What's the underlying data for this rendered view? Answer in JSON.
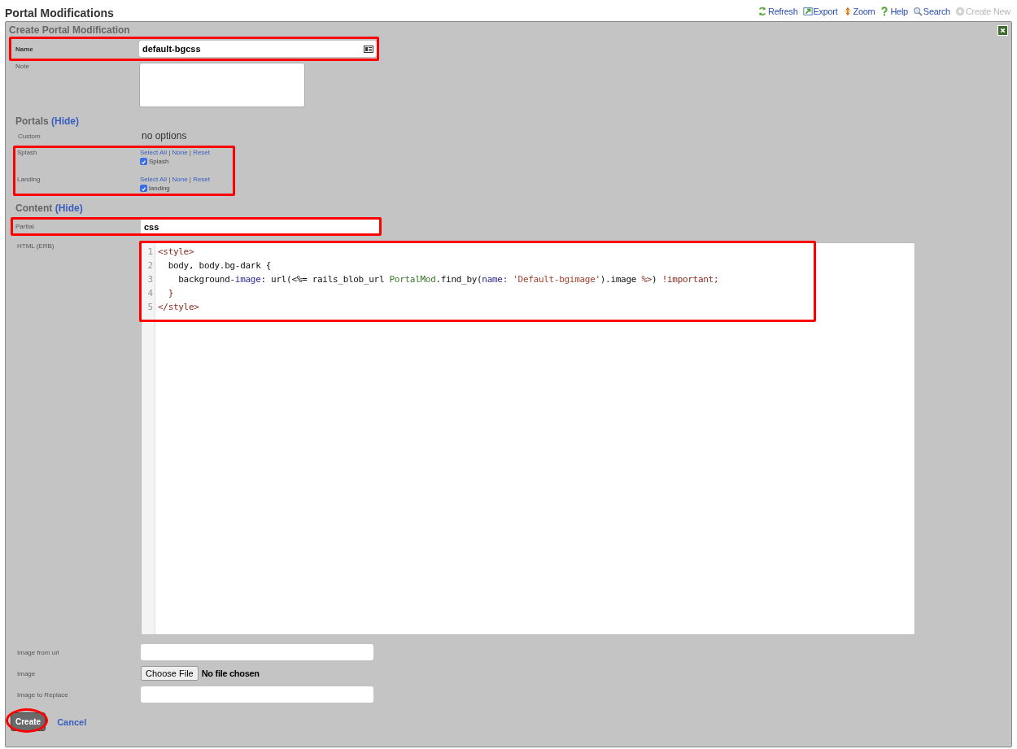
{
  "page_title": "Portal Modifications",
  "toolbar": [
    {
      "label": "Refresh",
      "kind": "refresh",
      "disabled": false
    },
    {
      "label": "Export",
      "kind": "export",
      "disabled": false
    },
    {
      "label": "Zoom",
      "kind": "zoom",
      "disabled": false
    },
    {
      "label": "Help",
      "kind": "help",
      "disabled": false
    },
    {
      "label": "Search",
      "kind": "search",
      "disabled": false
    },
    {
      "label": "Create New",
      "kind": "create",
      "disabled": true
    }
  ],
  "form": {
    "title": "Create Portal Modification",
    "name": {
      "label": "Name",
      "value": "default-bgcss",
      "highlighted": true
    },
    "note": {
      "label": "Note"
    },
    "portals": {
      "heading": "Portals",
      "toggle": "(Hide)",
      "custom": {
        "label": "Custom",
        "value": "no options"
      },
      "highlighted": true,
      "groups": [
        {
          "label": "Splash",
          "links": [
            "Select All",
            "None",
            "Reset"
          ],
          "separator": "|",
          "options": [
            {
              "label": "Splash",
              "checked": true
            }
          ]
        },
        {
          "label": "Landing",
          "links": [
            "Select All",
            "None",
            "Reset"
          ],
          "separator": "|",
          "options": [
            {
              "label": "landing",
              "checked": true
            }
          ]
        }
      ]
    },
    "content": {
      "heading": "Content",
      "toggle": "(Hide)",
      "partial": {
        "label": "Partial",
        "value": "css",
        "highlighted": true
      },
      "html": {
        "label": "HTML (ERB)",
        "highlighted": true,
        "lines": [
          {
            "number": "1",
            "tokens": [
              {
                "text": "<style>",
                "kind": "tag"
              }
            ]
          },
          {
            "number": "2",
            "tokens": [
              {
                "text": "  body, body.bg-dark {",
                "kind": "plain"
              }
            ]
          },
          {
            "number": "3",
            "tokens": [
              {
                "text": "    background-",
                "kind": "plain"
              },
              {
                "text": "image",
                "kind": "attr"
              },
              {
                "text": ": url(<%= rails_blob_url ",
                "kind": "plain"
              },
              {
                "text": "PortalMod",
                "kind": "const"
              },
              {
                "text": ".find_by(",
                "kind": "plain"
              },
              {
                "text": "name: ",
                "kind": "attr"
              },
              {
                "text": "'Default-bgimage'",
                "kind": "string"
              },
              {
                "text": ").image ",
                "kind": "plain"
              },
              {
                "text": "%>",
                "kind": "tag"
              },
              {
                "text": ") ",
                "kind": "plain"
              },
              {
                "text": "!important;",
                "kind": "tag"
              }
            ]
          },
          {
            "number": "4",
            "tokens": [
              {
                "text": "  }",
                "kind": "tag"
              }
            ]
          },
          {
            "number": "5",
            "tokens": [
              {
                "text": "</style>",
                "kind": "tag"
              }
            ]
          }
        ]
      }
    },
    "image_url": {
      "label": "Image from url"
    },
    "image": {
      "label": "Image",
      "button": "Choose File",
      "status": "No file chosen"
    },
    "image_replace": {
      "label": "Image to Replace"
    },
    "buttons": {
      "submit": "Create",
      "cancel": "Cancel",
      "submit_highlighted": true
    }
  }
}
